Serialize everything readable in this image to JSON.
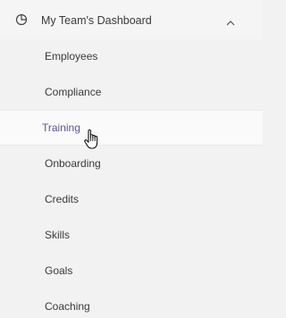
{
  "menu": {
    "section": {
      "title": "My Team's Dashboard",
      "icon": "pie-chart-icon",
      "expand_icon": "chevron-up-icon",
      "expanded": true
    },
    "items": [
      {
        "label": "Employees",
        "active": false
      },
      {
        "label": "Compliance",
        "active": false
      },
      {
        "label": "Training",
        "active": true
      },
      {
        "label": "Onboarding",
        "active": false
      },
      {
        "label": "Credits",
        "active": false
      },
      {
        "label": "Skills",
        "active": false
      },
      {
        "label": "Goals",
        "active": false
      },
      {
        "label": "Coaching",
        "active": false
      }
    ]
  },
  "colors": {
    "background": "#f2f2f2",
    "active_background": "#fafafa",
    "text": "#3a3a3a",
    "active_text": "#5b5591"
  },
  "cursor": {
    "icon": "hand-pointer-cursor",
    "target": "Training"
  }
}
